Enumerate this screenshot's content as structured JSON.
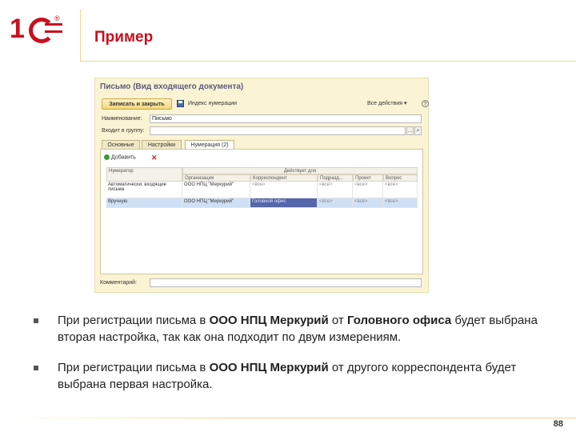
{
  "slide": {
    "title": "Пример",
    "page_number": "88"
  },
  "window": {
    "title": "Письмо (Вид входящего документа)",
    "toolbar": {
      "save_close": "Записать и закрыть",
      "index": "Индекс нумерации",
      "actions": "Все действия ▾",
      "help": "?"
    },
    "fields": {
      "name_label": "Наименование:",
      "name_value": "Письмо",
      "group_label": "Входит в группу:",
      "group_value": ""
    },
    "tabs": [
      "Основные",
      "Настройки",
      "Нумерация (2)"
    ],
    "active_tab": 2,
    "add_button": "Добавить",
    "table": {
      "headers": {
        "numerator": "Нумератор",
        "applies": "Действует для",
        "columns": [
          "Организация",
          "Корреспондент",
          "Подразд...",
          "Проект",
          "Вопрос"
        ]
      },
      "rows": [
        {
          "numerator": "Автоматически, входящие письма",
          "cells": [
            "ООО НПЦ \"Меркурий\"",
            "<все>",
            "<все>",
            "<все>",
            "<все>"
          ]
        },
        {
          "numerator": "Вручную",
          "cells": [
            "ООО НПЦ \"Меркурий\"",
            "Головной офис",
            "<все>",
            "<все>",
            "<все>"
          ]
        }
      ]
    },
    "comment_label": "Комментарий:"
  },
  "bullets": [
    {
      "parts": [
        {
          "t": "При регистрации письма в "
        },
        {
          "t": "ООО НПЦ Меркурий",
          "b": true
        },
        {
          "t": " от "
        },
        {
          "t": "Головного офиса",
          "b": true
        },
        {
          "t": " будет выбрана вторая настройка, так как она подходит по двум измерениям."
        }
      ]
    },
    {
      "parts": [
        {
          "t": "При регистрации письма в "
        },
        {
          "t": "ООО НПЦ Меркурий",
          "b": true
        },
        {
          "t": " от другого корреспондента будет выбрана первая настройка."
        }
      ]
    }
  ],
  "colors": {
    "brand_red": "#c8101e",
    "window_bg": "#fbf4d4",
    "selection": "#cfe0f5",
    "highlight": "#5566aa"
  }
}
